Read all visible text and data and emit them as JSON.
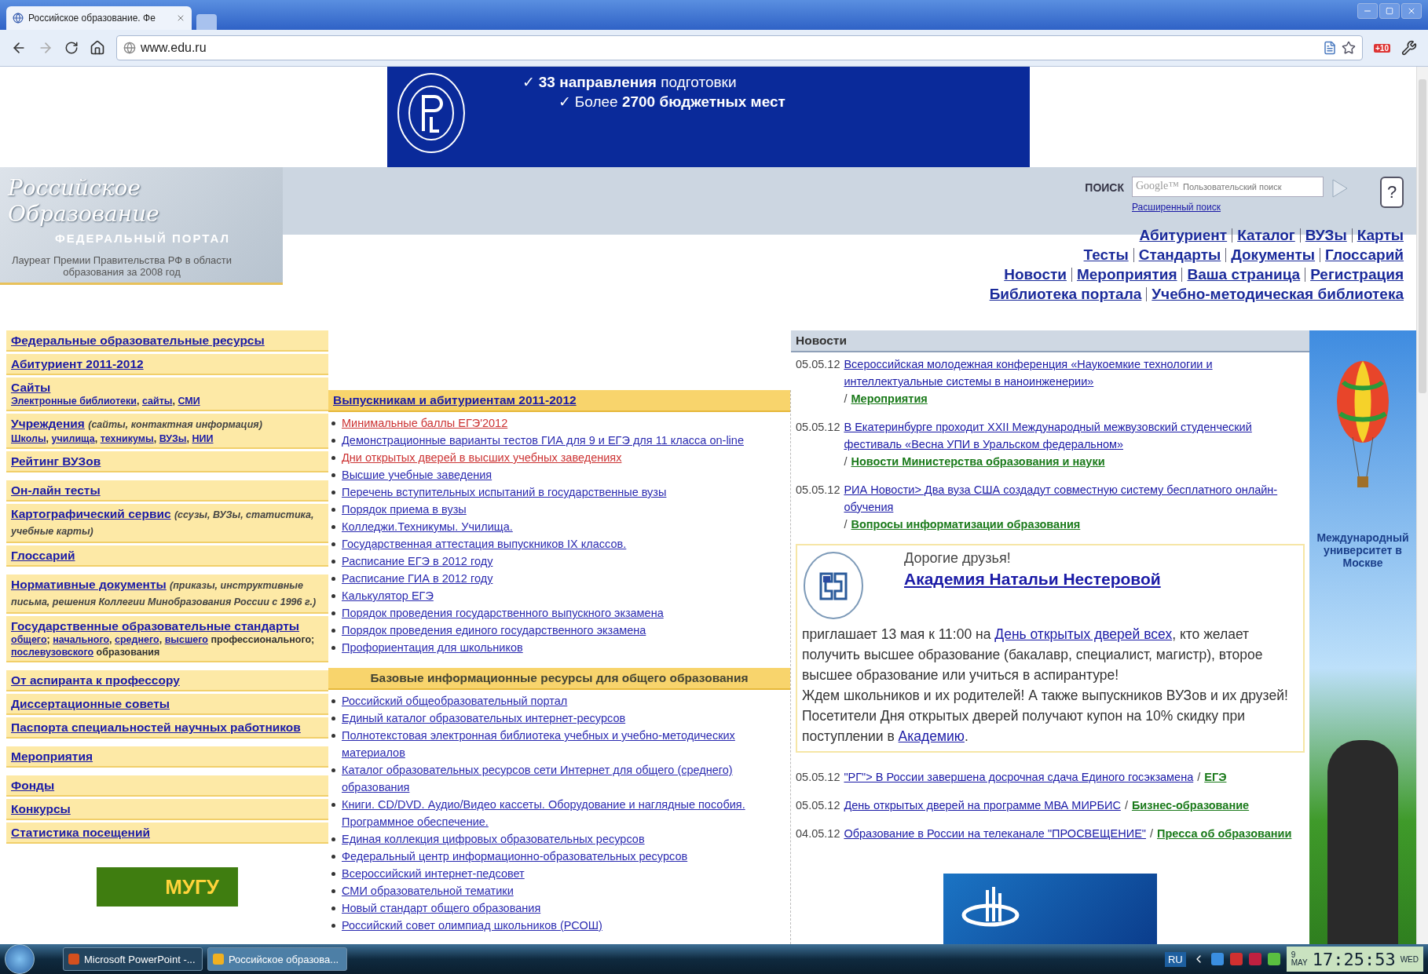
{
  "browser": {
    "tab_title": "Российское образование. Фе",
    "url": "www.edu.ru",
    "badge": "+10"
  },
  "banner": {
    "lines": [
      "✓ **33 направления** подготовки",
      "✓ Более **2700 бюджетных мест**"
    ]
  },
  "header": {
    "logo_title": "Российское Образование",
    "logo_subtitle": "ФЕДЕРАЛЬНЫЙ ПОРТАЛ",
    "award": "Лауреат Премии Правительства РФ в области образования за 2008 год",
    "search": {
      "label": "ПОИСК",
      "brand": "Google™",
      "placeholder": "Пользовательский поиск",
      "advanced": "Расширенный поиск",
      "help": "?"
    },
    "nav_rows": [
      [
        "Абитуриент",
        "Каталог",
        "ВУЗы",
        "Карты"
      ],
      [
        "Тесты",
        "Стандарты",
        "Документы",
        "Глоссарий"
      ],
      [
        "Новости",
        "Мероприятия",
        "Ваша страница",
        "Регистрация"
      ],
      [
        "Библиотека портала",
        "Учебно-методическая библиотека"
      ]
    ]
  },
  "sidebar": {
    "groups": [
      [
        {
          "title": "Федеральные образовательные ресурсы"
        },
        {
          "title": "Абитуриент 2011-2012"
        },
        {
          "title": "Сайты",
          "sub": [
            {
              "text": "Электронные библиотеки",
              "link": true
            },
            {
              "text": ", ",
              "link": false
            },
            {
              "text": "сайты",
              "link": true
            },
            {
              "text": ", ",
              "link": false
            },
            {
              "text": "СМИ",
              "link": true
            }
          ]
        },
        {
          "title": "Учреждения",
          "note": "(сайты, контактная информация)",
          "sub": [
            {
              "text": "Школы",
              "link": true
            },
            {
              "text": ", ",
              "link": false
            },
            {
              "text": "училища",
              "link": true
            },
            {
              "text": ", ",
              "link": false
            },
            {
              "text": "техникумы",
              "link": true
            },
            {
              "text": ", ",
              "link": false
            },
            {
              "text": "ВУЗы",
              "link": true
            },
            {
              "text": ", ",
              "link": false
            },
            {
              "text": "НИИ",
              "link": true
            }
          ]
        },
        {
          "title": "Рейтинг ВУЗов"
        }
      ],
      [
        {
          "title": "Он-лайн тесты"
        },
        {
          "title": "Картографический сервис",
          "note": "(ссузы, ВУЗы, статистика, учебные карты)"
        },
        {
          "title": "Глоссарий"
        }
      ],
      [
        {
          "title": "Нормативные документы",
          "note": "(приказы, инструктивные письма, решения Коллегии Минобразования России с 1996 г.)"
        },
        {
          "title": "Государственные образовательные стандарты",
          "sub": [
            {
              "text": "общего",
              "link": true
            },
            {
              "text": "; ",
              "link": false
            },
            {
              "text": "начального",
              "link": true
            },
            {
              "text": ", ",
              "link": false
            },
            {
              "text": "среднего",
              "link": true
            },
            {
              "text": ", ",
              "link": false
            },
            {
              "text": "высшего",
              "link": true
            },
            {
              "text": " профессионального; ",
              "link": false
            },
            {
              "text": "послевузовского",
              "link": true
            },
            {
              "text": " образования",
              "link": false
            }
          ]
        }
      ],
      [
        {
          "title": "От аспиранта к профессору"
        },
        {
          "title": "Диссертационные советы"
        },
        {
          "title": "Паспорта специальностей научных работников"
        }
      ],
      [
        {
          "title": "Мероприятия"
        }
      ],
      [
        {
          "title": "Фонды"
        },
        {
          "title": "Конкурсы"
        },
        {
          "title": "Статистика посещений"
        }
      ]
    ],
    "bottom_logo": "МУГУ"
  },
  "center": {
    "sections": [
      {
        "title": "Выпускникам и абитуриентам 2011-2012",
        "title_is_link": true,
        "items": [
          {
            "text": "Минимальные баллы ЕГЭ'2012",
            "color": "#cc3333"
          },
          {
            "text": "Демонстрационные варианты тестов ГИА для 9 и ЕГЭ для 11 класса on-line",
            "color": "#2a2ab0"
          },
          {
            "text": "Дни открытых дверей в высших учебных заведениях",
            "color": "#cc3333"
          },
          {
            "text": "Высшие учебные заведения",
            "color": "#2a2ab0"
          },
          {
            "text": "Перечень вступительных испытаний в государственные вузы",
            "color": "#2a2ab0"
          },
          {
            "text": "Порядок приема в вузы",
            "color": "#2a2ab0"
          },
          {
            "text": "Колледжи.Техникумы. Училища.",
            "color": "#2a2ab0"
          },
          {
            "text": "Государственная аттестация выпускников IX классов.",
            "color": "#2a2ab0"
          },
          {
            "text": "Расписание ЕГЭ в 2012 году",
            "color": "#2a2ab0"
          },
          {
            "text": "Расписание ГИА в 2012 году",
            "color": "#2a2ab0"
          },
          {
            "text": "Калькулятор ЕГЭ",
            "color": "#2a2ab0"
          },
          {
            "text": "Порядок проведения государственного выпускного экзамена",
            "color": "#2a2ab0"
          },
          {
            "text": "Порядок проведения единого государственного экзамена",
            "color": "#2a2ab0"
          },
          {
            "text": "Профориентация для школьников",
            "color": "#2a2ab0"
          }
        ]
      },
      {
        "title": "Базовые информационные ресурсы для общего образования",
        "title_is_link": false,
        "items": [
          {
            "text": "Российский общеобразовательный портал",
            "color": "#2a2ab0"
          },
          {
            "text": "Единый каталог образовательных интернет-ресурсов",
            "color": "#2a2ab0"
          },
          {
            "text": "Полнотекстовая электронная библиотека учебных и учебно-методических материалов",
            "color": "#2a2ab0"
          },
          {
            "text": "Каталог образовательных ресурсов сети Интернет для общего (среднего) образования",
            "color": "#2a2ab0"
          },
          {
            "text": "Книги. CD/DVD. Аудио/Видео кассеты. Оборудование и наглядные пособия. Программное обеспечение.",
            "color": "#2a2ab0"
          },
          {
            "text": "Единая коллекция цифровых образовательных ресурсов",
            "color": "#2a2ab0"
          },
          {
            "text": "Федеральный центр информационно-образовательных ресурсов",
            "color": "#2a2ab0"
          },
          {
            "text": "Всероссийский интернет-педсовет",
            "color": "#2a2ab0"
          },
          {
            "text": "СМИ образовательной тематики",
            "color": "#2a2ab0"
          },
          {
            "text": "Новый стандарт общего образования",
            "color": "#2a2ab0"
          },
          {
            "text": "Российский совет олимпиад школьников (РСОШ)",
            "color": "#2a2ab0"
          }
        ]
      }
    ]
  },
  "news": {
    "title": "Новости",
    "items": [
      {
        "kind": "news",
        "date": "05.05.12",
        "text": "Всероссийская молодежная конференция «Наукоемкие технологии и интеллектуальные системы в наноинженерии»",
        "sep": "/",
        "category": "Мероприятия"
      },
      {
        "kind": "news",
        "date": "05.05.12",
        "text": "В Екатеринбурге проходит XXII Международный межвузовский студенческий фестиваль «Весна УПИ в Уральском федеральном»",
        "sep": "/",
        "category": "Новости Министерства образования и науки"
      },
      {
        "kind": "news",
        "date": "05.05.12",
        "text": "РИА Новости> Два вуза США создадут совместную систему бесплатного онлайн-обучения",
        "sep": "/",
        "category": "Вопросы информатизации образования"
      },
      {
        "kind": "promo",
        "greeting": "Дорогие друзья!",
        "title": "Академия Натальи Нестеровой",
        "body": [
          {
            "text": "приглашает 13 мая к 11:00 на ",
            "link": false
          },
          {
            "text": "День открытых дверей всех",
            "link": true
          },
          {
            "text": ", кто желает получить высшее образование (бакалавр, специалист, магистр), второе высшее образование или учиться в аспирантуре!\nЖдем школьников и их родителей! А также выпускников ВУЗов и их друзей!\nПосетители Дня открытых дверей получают купон на 10% скидку при поступлении в ",
            "link": false
          },
          {
            "text": "Академию",
            "link": true
          },
          {
            "text": ".",
            "link": false
          }
        ]
      },
      {
        "kind": "news",
        "date": "05.05.12",
        "text": "\"РГ\"> В России завершена досрочная сдача Единого госэкзамена",
        "sep": "/",
        "category": "ЕГЭ"
      },
      {
        "kind": "news",
        "date": "05.05.12",
        "text": "День открытых дверей на программе МВА МИРБИС",
        "sep": "/",
        "category": "Бизнес-образование"
      },
      {
        "kind": "news",
        "date": "04.05.12",
        "text": "Образование в России на телеканале \"ПРОСВЕЩЕНИЕ\"",
        "sep": "/",
        "category": "Пресса об образовании"
      }
    ]
  },
  "side_ad": {
    "text": "Международный университет в Москве"
  },
  "taskbar": {
    "tasks": [
      {
        "label": "Microsoft PowerPoint -...",
        "selected": false
      },
      {
        "label": "Российское образова...",
        "selected": true
      }
    ],
    "language": "RU",
    "day": "9",
    "month": "MAY",
    "time": "17:25:53",
    "weekday": "WED"
  }
}
